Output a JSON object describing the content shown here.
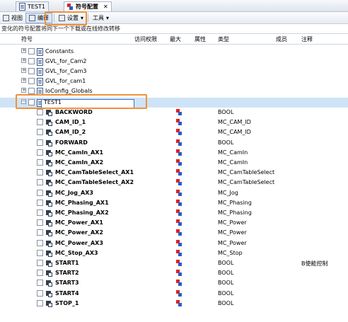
{
  "tabs": [
    {
      "label": "TEST1"
    },
    {
      "label": "符号配置",
      "close": "✕"
    }
  ],
  "toolbar": {
    "view_label": "视图",
    "compile_label": "编译",
    "settings_label": "设置",
    "tools_label": "工具",
    "dropdown": "▾"
  },
  "info_text": "变化的符号配置将同下一个下载或在线修改转移",
  "columns": {
    "symbol": "符号",
    "access": "访问权限",
    "max": "最大",
    "attribute": "属性",
    "type": "类型",
    "member": "成员",
    "comment": "注释"
  },
  "folders": [
    {
      "name": "Constants"
    },
    {
      "name": "GVL_for_Cam2"
    },
    {
      "name": "GVL_for_Cam3"
    },
    {
      "name": "GVL_for_cam1"
    },
    {
      "name": "IoConfig_Globals"
    },
    {
      "name": "TEST1"
    }
  ],
  "expand_glyph": "+",
  "collapse_glyph": "−",
  "variables": [
    {
      "name": "BACKWORD",
      "type": "BOOL",
      "comment": ""
    },
    {
      "name": "CAM_ID_1",
      "type": "MC_CAM_ID",
      "comment": ""
    },
    {
      "name": "CAM_ID_2",
      "type": "MC_CAM_ID",
      "comment": ""
    },
    {
      "name": "FORWARD",
      "type": "BOOL",
      "comment": ""
    },
    {
      "name": "MC_CamIn_AX1",
      "type": "MC_CamIn",
      "comment": ""
    },
    {
      "name": "MC_CamIn_AX2",
      "type": "MC_CamIn",
      "comment": ""
    },
    {
      "name": "MC_CamTableSelect_AX1",
      "type": "MC_CamTableSelect",
      "comment": ""
    },
    {
      "name": "MC_CamTableSelect_AX2",
      "type": "MC_CamTableSelect",
      "comment": ""
    },
    {
      "name": "MC_Jog_AX3",
      "type": "MC_Jog",
      "comment": ""
    },
    {
      "name": "MC_Phasing_AX1",
      "type": "MC_Phasing",
      "comment": ""
    },
    {
      "name": "MC_Phasing_AX2",
      "type": "MC_Phasing",
      "comment": ""
    },
    {
      "name": "MC_Power_AX1",
      "type": "MC_Power",
      "comment": ""
    },
    {
      "name": "MC_Power_AX2",
      "type": "MC_Power",
      "comment": ""
    },
    {
      "name": "MC_Power_AX3",
      "type": "MC_Power",
      "comment": ""
    },
    {
      "name": "MC_Stop_AX3",
      "type": "MC_Stop",
      "comment": ""
    },
    {
      "name": "START1",
      "type": "BOOL",
      "comment": "B使能控制"
    },
    {
      "name": "START2",
      "type": "BOOL",
      "comment": ""
    },
    {
      "name": "START3",
      "type": "BOOL",
      "comment": ""
    },
    {
      "name": "START4",
      "type": "BOOL",
      "comment": ""
    },
    {
      "name": "STOP_1",
      "type": "BOOL",
      "comment": ""
    }
  ]
}
